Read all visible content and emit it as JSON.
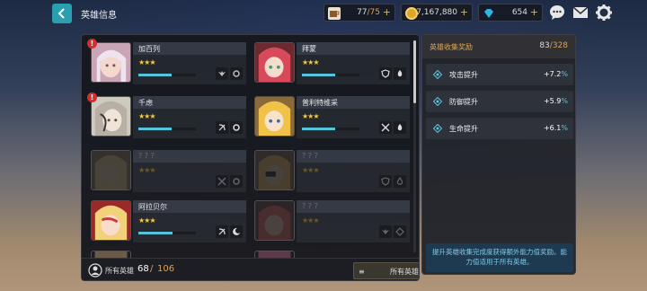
{
  "header": {
    "title": "英雄信息"
  },
  "resources": {
    "stamina": {
      "current": "77",
      "max": "/75",
      "icon": "coffee-cup-icon"
    },
    "gold": {
      "value": "7,167,880",
      "icon": "gold-coin-icon"
    },
    "gems": {
      "value": "654",
      "icon": "diamond-icon"
    }
  },
  "heroes": [
    {
      "name": "加百列",
      "stars": "★★★",
      "locked": false,
      "alert": "!",
      "progress": 0.58,
      "skills": [
        "wings-skill-icon",
        "gear-skill-icon"
      ]
    },
    {
      "name": "拜蒙",
      "stars": "★★★",
      "locked": false,
      "alert": "",
      "progress": 0.58,
      "skills": [
        "shield-skill-icon",
        "fire-skill-icon"
      ]
    },
    {
      "name": "千虑",
      "stars": "★★★",
      "locked": false,
      "alert": "!",
      "progress": 0.58,
      "skills": [
        "bow-skill-icon",
        "gear-skill-icon"
      ]
    },
    {
      "name": "普利特维采",
      "stars": "★★★",
      "locked": false,
      "alert": "",
      "progress": 0.58,
      "skills": [
        "swords-skill-icon",
        "fire-skill-icon"
      ]
    },
    {
      "name": "? ? ?",
      "stars": "★★★",
      "locked": true,
      "alert": "",
      "progress": 0,
      "skills": [
        "swords-skill-icon",
        "gear-skill-icon"
      ]
    },
    {
      "name": "? ? ?",
      "stars": "★★★",
      "locked": true,
      "alert": "",
      "progress": 0,
      "skills": [
        "shield-skill-icon",
        "water-skill-icon"
      ]
    },
    {
      "name": "阿拉贝尔",
      "stars": "★★★",
      "locked": false,
      "alert": "",
      "progress": 0.6,
      "skills": [
        "bow-skill-icon",
        "moon-skill-icon"
      ]
    },
    {
      "name": "? ? ?",
      "stars": "★★★",
      "locked": true,
      "alert": "",
      "progress": 0,
      "skills": [
        "wings-skill-icon",
        "diamond-skill-icon"
      ]
    }
  ],
  "footer": {
    "label": "所有英雄",
    "current": "68",
    "separator": "/",
    "max": "106",
    "filter_label": "所有英雄"
  },
  "bonus": {
    "title": "英雄收集奖励",
    "count": "83",
    "count_max": "/328",
    "stats": [
      {
        "name": "攻击提升",
        "value": "+7.2",
        "unit": "%"
      },
      {
        "name": "防御提升",
        "value": "+5.9",
        "unit": "%"
      },
      {
        "name": "生命提升",
        "value": "+6.1",
        "unit": "%"
      }
    ],
    "description": "提升英雄收集完成度获得额外能力值奖励。能力值适用于所有英雄。"
  },
  "colors": {
    "accent": "#2a9fb0",
    "gold_text": "#e0a24a",
    "progress": "#58c4dc",
    "alert": "#d92d2d"
  }
}
